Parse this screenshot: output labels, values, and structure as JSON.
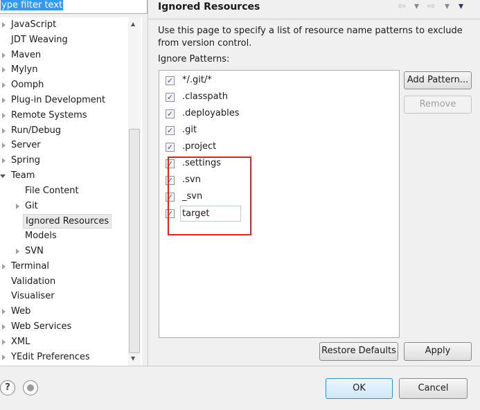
{
  "filter": {
    "value": "ype filter text"
  },
  "tree": [
    {
      "label": "JavaScript",
      "level": 0,
      "arrow": "right"
    },
    {
      "label": "JDT Weaving",
      "level": 0,
      "arrow": "none"
    },
    {
      "label": "Maven",
      "level": 0,
      "arrow": "right"
    },
    {
      "label": "Mylyn",
      "level": 0,
      "arrow": "right"
    },
    {
      "label": "Oomph",
      "level": 0,
      "arrow": "right"
    },
    {
      "label": "Plug-in Development",
      "level": 0,
      "arrow": "right"
    },
    {
      "label": "Remote Systems",
      "level": 0,
      "arrow": "right"
    },
    {
      "label": "Run/Debug",
      "level": 0,
      "arrow": "right"
    },
    {
      "label": "Server",
      "level": 0,
      "arrow": "right"
    },
    {
      "label": "Spring",
      "level": 0,
      "arrow": "right"
    },
    {
      "label": "Team",
      "level": 0,
      "arrow": "down"
    },
    {
      "label": "File Content",
      "level": 1,
      "arrow": "none"
    },
    {
      "label": "Git",
      "level": 1,
      "arrow": "right"
    },
    {
      "label": "Ignored Resources",
      "level": 1,
      "arrow": "none",
      "selected": true
    },
    {
      "label": "Models",
      "level": 1,
      "arrow": "none"
    },
    {
      "label": "SVN",
      "level": 1,
      "arrow": "right"
    },
    {
      "label": "Terminal",
      "level": 0,
      "arrow": "right"
    },
    {
      "label": "Validation",
      "level": 0,
      "arrow": "none"
    },
    {
      "label": "Visualiser",
      "level": 0,
      "arrow": "none"
    },
    {
      "label": "Web",
      "level": 0,
      "arrow": "right"
    },
    {
      "label": "Web Services",
      "level": 0,
      "arrow": "right"
    },
    {
      "label": "XML",
      "level": 0,
      "arrow": "right"
    },
    {
      "label": "YEdit Preferences",
      "level": 0,
      "arrow": "right"
    }
  ],
  "page": {
    "title": "Ignored Resources",
    "nav": {
      "back": "⇦",
      "back_menu": "▾",
      "forward": "⇨",
      "forward_menu": "▾",
      "view_menu": "▾"
    },
    "description": "Use this page to specify a list of resource name patterns to exclude from version control.",
    "patterns_label": "Ignore Patterns:",
    "patterns": [
      {
        "label": "*/.git/*",
        "checked": true
      },
      {
        "label": ".classpath",
        "checked": true
      },
      {
        "label": ".deployables",
        "checked": true
      },
      {
        "label": ".git",
        "checked": true
      },
      {
        "label": ".project",
        "checked": true
      },
      {
        "label": ".settings",
        "checked": true
      },
      {
        "label": ".svn",
        "checked": true
      },
      {
        "label": "_svn",
        "checked": true
      },
      {
        "label": "target",
        "checked": true,
        "editing": true
      }
    ],
    "add_pattern": "Add Pattern...",
    "remove": "Remove",
    "restore_defaults": "Restore Defaults",
    "apply": "Apply"
  },
  "footer": {
    "help": "?",
    "ok": "OK",
    "cancel": "Cancel"
  },
  "colors": {
    "selection": "#3399ff",
    "highlight_box": "#e82020",
    "check": "#3a4fa8"
  }
}
